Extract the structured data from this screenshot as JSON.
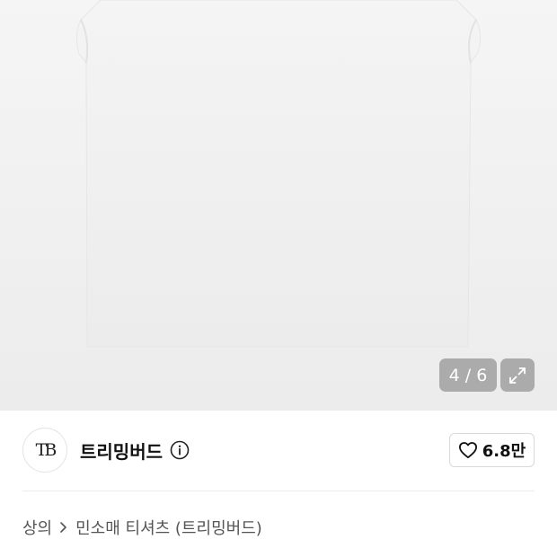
{
  "gallery": {
    "counter_current": "4",
    "counter_total": "6",
    "counter_text": "4 / 6",
    "expand_icon": "expand-icon"
  },
  "brand": {
    "logo_text": "TB",
    "name": "트리밍버드",
    "info_icon": "info-icon"
  },
  "like": {
    "icon": "heart-icon",
    "count": "6.8만"
  },
  "breadcrumb": {
    "items": [
      "상의",
      "민소매 티셔츠 (트리밍버드)"
    ],
    "separator_icon": "chevron-right-icon"
  },
  "colors": {
    "gallery_bg": "#efefef",
    "overlay": "#8a8a8a",
    "text_primary": "#111111",
    "text_secondary": "#555555"
  }
}
